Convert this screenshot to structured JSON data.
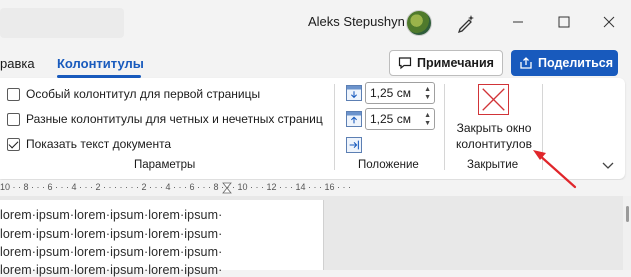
{
  "titlebar": {
    "user_name": "Aleks Stepushyn",
    "icons": [
      "pen-sparkle-icon",
      "minimize-icon",
      "restore-icon",
      "close-icon"
    ]
  },
  "tabs": [
    {
      "label": "равка",
      "active": false
    },
    {
      "label": "Колонтитулы",
      "active": true
    }
  ],
  "actions": {
    "comments_label": "Примечания",
    "share_label": "Поделиться",
    "accent_color": "#185abd"
  },
  "ribbon": {
    "options_group": {
      "label": "Параметры",
      "checkboxes": [
        {
          "label": "Особый колонтитул для первой страницы",
          "checked": false
        },
        {
          "label": "Разные колонтитулы для четных и нечетных страниц",
          "checked": false
        },
        {
          "label": "Показать текст документа",
          "checked": true
        }
      ]
    },
    "position_group": {
      "label": "Положение",
      "header_from_top": "1,25 см",
      "footer_from_bottom": "1,25 см"
    },
    "close_group": {
      "label": "Закрытие",
      "close_button_line1": "Закрыть окно",
      "close_button_line2": "колонтитулов"
    }
  },
  "ruler": {
    "marks": "10 · · 8 · · · 6 · · · 4 · · · 2 · · · · · · · 2 · · · 4 · · · 6 · · · 8 · · · 10 · · · 12 · · · 14 · · · 16 · · ·"
  },
  "document": {
    "lines": [
      "lorem·ipsum·lorem·ipsum·lorem·ipsum·",
      "lorem·ipsum·lorem·ipsum·lorem·ipsum·",
      "lorem·ipsum·lorem·ipsum·lorem·ipsum·",
      "lorem·ipsum·lorem·ipsum·lorem·ipsum·"
    ]
  },
  "annotation": {
    "arrow_color": "#e0262b"
  }
}
